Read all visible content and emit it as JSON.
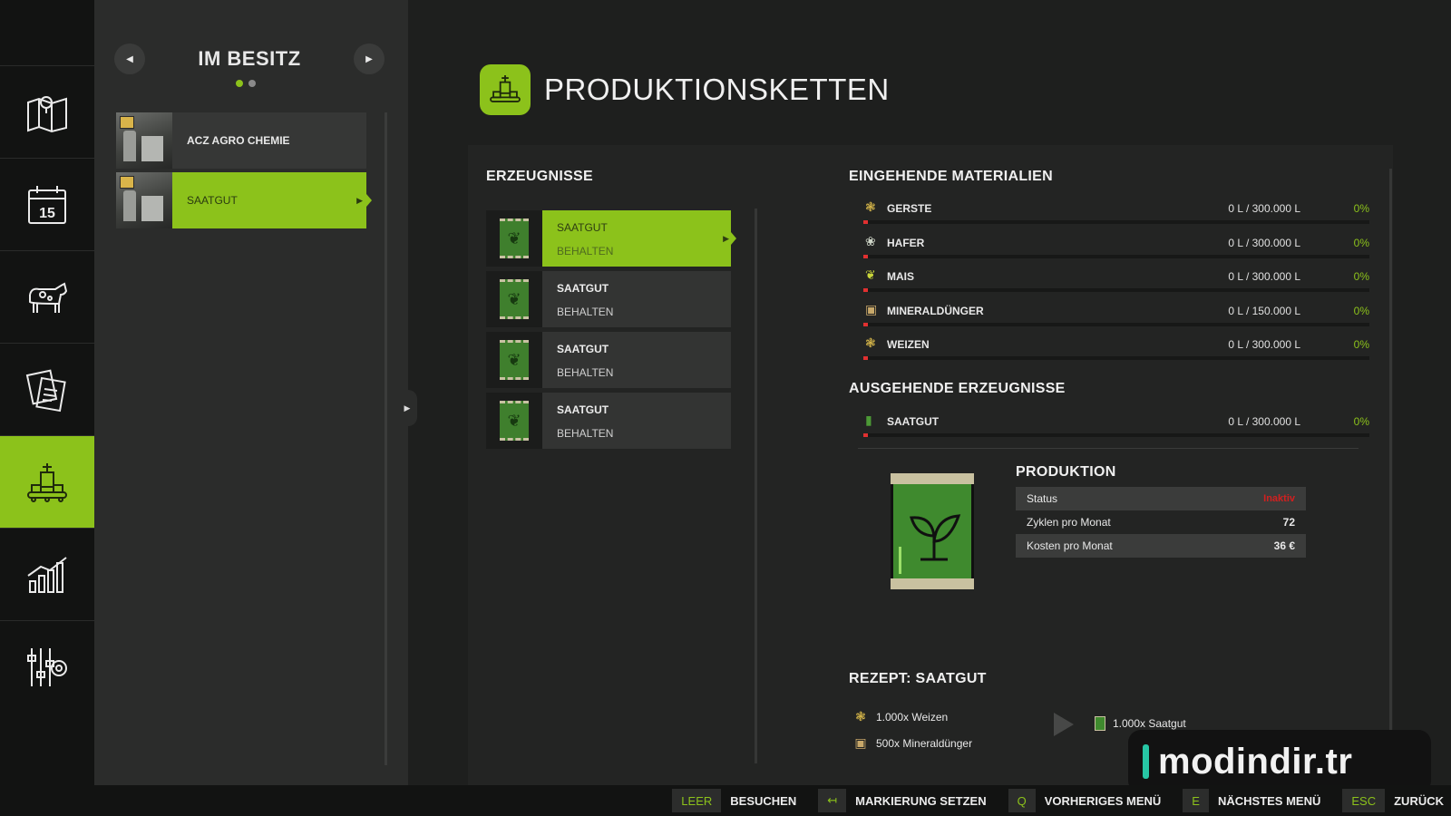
{
  "rail": {
    "items": [
      {
        "icon": "map-icon"
      },
      {
        "icon": "calendar-icon",
        "text": "15"
      },
      {
        "icon": "cow-icon"
      },
      {
        "icon": "contracts-icon"
      },
      {
        "icon": "production-icon"
      },
      {
        "icon": "statistics-icon"
      },
      {
        "icon": "settings-icon"
      }
    ],
    "active_index": 4
  },
  "owned": {
    "title": "IM BESITZ",
    "items": [
      {
        "label": "ACZ AGRO CHEMIE"
      },
      {
        "label": "SAATGUT"
      }
    ]
  },
  "main": {
    "title": "PRODUKTIONSKETTEN"
  },
  "products": {
    "heading": "ERZEUGNISSE",
    "items": [
      {
        "name": "SAATGUT",
        "mode": "BEHALTEN"
      },
      {
        "name": "SAATGUT",
        "mode": "BEHALTEN"
      },
      {
        "name": "SAATGUT",
        "mode": "BEHALTEN"
      },
      {
        "name": "SAATGUT",
        "mode": "BEHALTEN"
      }
    ]
  },
  "incoming": {
    "heading": "EINGEHENDE MATERIALIEN",
    "items": [
      {
        "name": "GERSTE",
        "amount": "0 L / 300.000 L",
        "percent": "0%",
        "fill": 0
      },
      {
        "name": "HAFER",
        "amount": "0 L / 300.000 L",
        "percent": "0%",
        "fill": 0
      },
      {
        "name": "MAIS",
        "amount": "0 L / 300.000 L",
        "percent": "0%",
        "fill": 0
      },
      {
        "name": "MINERALDÜNGER",
        "amount": "0 L / 150.000 L",
        "percent": "0%",
        "fill": 0
      },
      {
        "name": "WEIZEN",
        "amount": "0 L / 300.000 L",
        "percent": "0%",
        "fill": 0
      }
    ]
  },
  "outgoing": {
    "heading": "AUSGEHENDE ERZEUGNISSE",
    "items": [
      {
        "name": "SAATGUT",
        "amount": "0 L / 300.000 L",
        "percent": "0%",
        "fill": 0
      }
    ]
  },
  "production": {
    "heading": "PRODUKTION",
    "status_label": "Status",
    "status_value": "Inaktiv",
    "cycles_label": "Zyklen pro Monat",
    "cycles_value": "72",
    "costs_label": "Kosten pro Monat",
    "costs_value": "36 €"
  },
  "recipe": {
    "heading": "REZEPT: SAATGUT",
    "inputs": [
      "1.000x Weizen",
      "500x Mineraldünger"
    ],
    "output": "1.000x Saatgut"
  },
  "watermark": "modindir.tr",
  "footer": [
    {
      "key": "LEER",
      "label": "BESUCHEN"
    },
    {
      "key": "↤",
      "label": "MARKIERUNG SETZEN"
    },
    {
      "key": "Q",
      "label": "VORHERIGES MENÜ"
    },
    {
      "key": "E",
      "label": "NÄCHSTES MENÜ"
    },
    {
      "key": "ESC",
      "label": "ZURÜCK"
    }
  ],
  "colors": {
    "accent": "#8cc21b",
    "danger": "#d02020",
    "panel": "#2b2c2b",
    "rail": "#121312"
  }
}
